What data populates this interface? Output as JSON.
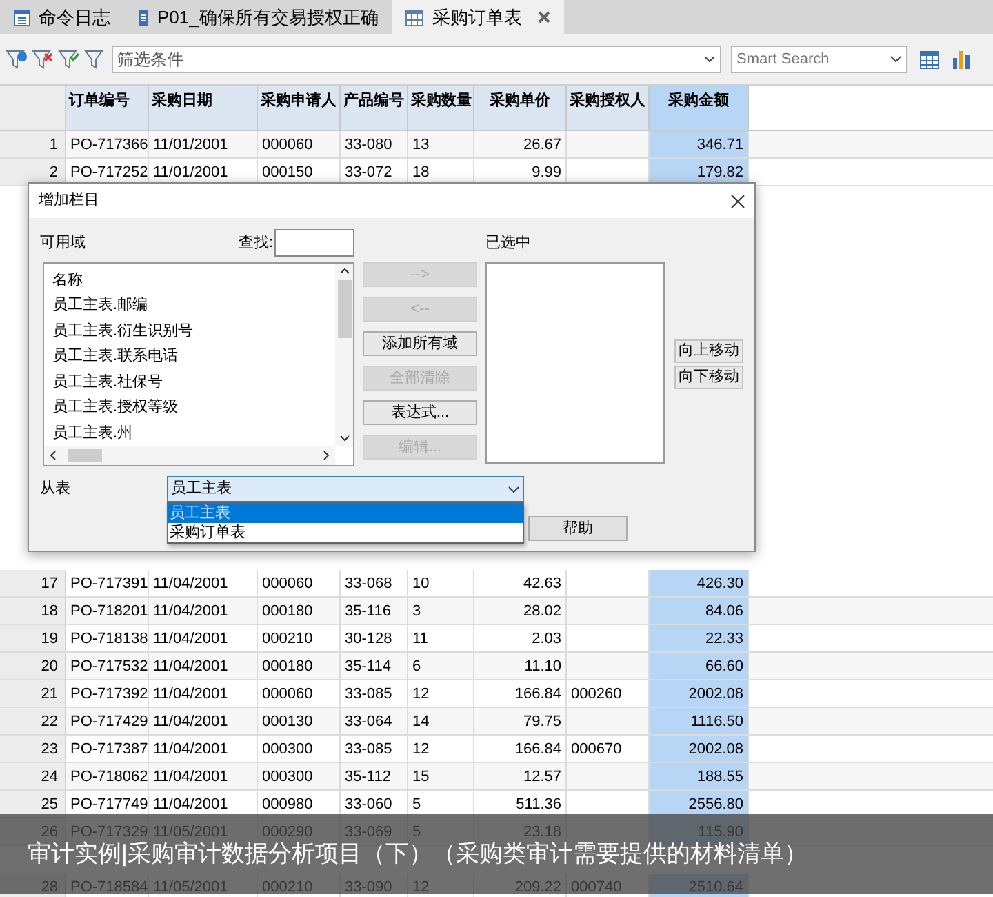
{
  "tabs": [
    {
      "label": "命令日志",
      "selected": false,
      "closable": false
    },
    {
      "label": "P01_确保所有交易授权正确",
      "selected": false,
      "closable": false
    },
    {
      "label": "采购订单表",
      "selected": true,
      "closable": true
    }
  ],
  "toolbar": {
    "filter_placeholder": "筛选条件",
    "search_placeholder": "Smart Search"
  },
  "table": {
    "columns": [
      {
        "label": "订单编号",
        "highlighted": false
      },
      {
        "label": "采购日期",
        "highlighted": false
      },
      {
        "label": "采购申请人",
        "highlighted": false
      },
      {
        "label": "产品编号",
        "highlighted": false
      },
      {
        "label": "采购数量",
        "highlighted": false
      },
      {
        "label": "采购单价",
        "highlighted": false
      },
      {
        "label": "采购授权人",
        "highlighted": false
      },
      {
        "label": "采购金额",
        "highlighted": true
      }
    ],
    "rows_top": [
      {
        "number": "1",
        "cells": [
          "PO-717366",
          "11/01/2001",
          "000060",
          "33-080",
          "13",
          "26.67",
          "",
          "346.71"
        ]
      },
      {
        "number": "2",
        "cells": [
          "PO-717252",
          "11/01/2001",
          "000150",
          "33-072",
          "18",
          "9.99",
          "",
          "179.82"
        ]
      }
    ],
    "rows_bottom": [
      {
        "number": "17",
        "cells": [
          "PO-717391",
          "11/04/2001",
          "000060",
          "33-068",
          "10",
          "42.63",
          "",
          "426.30"
        ]
      },
      {
        "number": "18",
        "cells": [
          "PO-718201",
          "11/04/2001",
          "000180",
          "35-116",
          "3",
          "28.02",
          "",
          "84.06"
        ]
      },
      {
        "number": "19",
        "cells": [
          "PO-718138",
          "11/04/2001",
          "000210",
          "30-128",
          "11",
          "2.03",
          "",
          "22.33"
        ]
      },
      {
        "number": "20",
        "cells": [
          "PO-717532",
          "11/04/2001",
          "000180",
          "35-114",
          "6",
          "11.10",
          "",
          "66.60"
        ]
      },
      {
        "number": "21",
        "cells": [
          "PO-717392",
          "11/04/2001",
          "000060",
          "33-085",
          "12",
          "166.84",
          "000260",
          "2002.08"
        ]
      },
      {
        "number": "22",
        "cells": [
          "PO-717429",
          "11/04/2001",
          "000130",
          "33-064",
          "14",
          "79.75",
          "",
          "1116.50"
        ]
      },
      {
        "number": "23",
        "cells": [
          "PO-717387",
          "11/04/2001",
          "000300",
          "33-085",
          "12",
          "166.84",
          "000670",
          "2002.08"
        ]
      },
      {
        "number": "24",
        "cells": [
          "PO-718062",
          "11/04/2001",
          "000300",
          "35-112",
          "15",
          "12.57",
          "",
          "188.55"
        ]
      },
      {
        "number": "25",
        "cells": [
          "PO-717749",
          "11/04/2001",
          "000980",
          "33-060",
          "5",
          "511.36",
          "",
          "2556.80"
        ]
      },
      {
        "number": "26",
        "cells": [
          "PO-717329",
          "11/05/2001",
          "000290",
          "33-069",
          "5",
          "23.18",
          "",
          "115.90"
        ]
      }
    ],
    "rows_last": [
      {
        "number": "28",
        "cells": [
          "PO-718584",
          "11/05/2001",
          "000210",
          "33-090",
          "12",
          "209.22",
          "000740",
          "2510.64"
        ]
      }
    ]
  },
  "dialog": {
    "title": "增加栏目",
    "available_label": "可用域",
    "find_label": "查找:",
    "selected_label": "已选中",
    "fields": [
      "名称",
      "员工主表.邮编",
      "员工主表.衍生识别号",
      "员工主表.联系电话",
      "员工主表.社保号",
      "员工主表.授权等级",
      "员工主表.州"
    ],
    "middle_buttons": [
      {
        "label": "-->",
        "disabled": true
      },
      {
        "label": "<--",
        "disabled": true
      },
      {
        "label": "添加所有域",
        "disabled": false
      },
      {
        "label": "全部清除",
        "disabled": true
      },
      {
        "label": "表达式...",
        "disabled": false
      },
      {
        "label": "编辑...",
        "disabled": true
      }
    ],
    "move_buttons": [
      "向上移动",
      "向下移动"
    ],
    "from_table_label": "从表",
    "from_table_value": "员工主表",
    "options": [
      {
        "label": "员工主表",
        "selected": true
      },
      {
        "label": "采购订单表",
        "selected": false
      }
    ],
    "help_button": "帮助"
  },
  "caption": "审计实例|采购审计数据分析项目（下）（采购类审计需要提供的材料清单）"
}
